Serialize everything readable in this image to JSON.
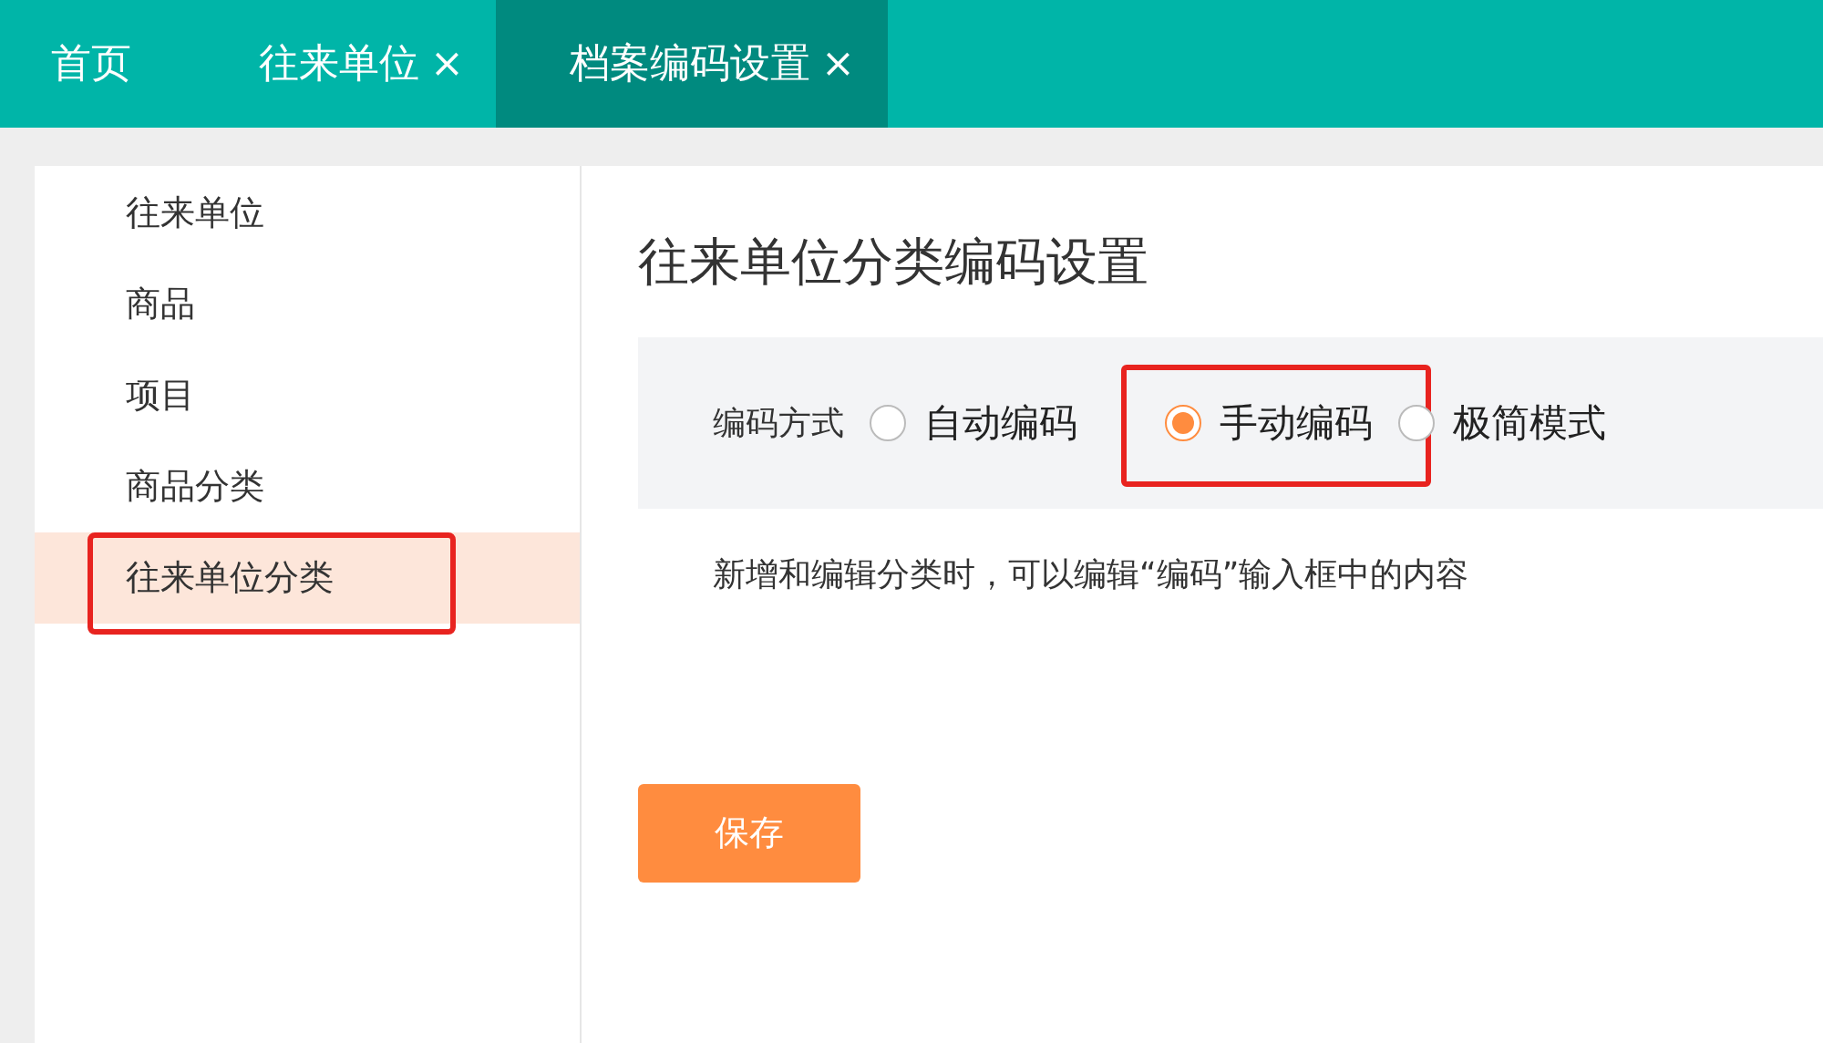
{
  "tabs": [
    {
      "label": "首页",
      "closable": false,
      "selected": false
    },
    {
      "label": "往来单位",
      "closable": true,
      "selected": false
    },
    {
      "label": "档案编码设置",
      "closable": true,
      "selected": true
    }
  ],
  "close_glyph": "×",
  "sidebar": {
    "items": [
      {
        "label": "往来单位",
        "selected": false,
        "highlighted": false
      },
      {
        "label": "商品",
        "selected": false,
        "highlighted": false
      },
      {
        "label": "项目",
        "selected": false,
        "highlighted": false
      },
      {
        "label": "商品分类",
        "selected": false,
        "highlighted": false
      },
      {
        "label": "往来单位分类",
        "selected": true,
        "highlighted": true
      }
    ]
  },
  "content": {
    "title": "往来单位分类编码设置",
    "coding_mode": {
      "label": "编码方式",
      "options": [
        {
          "label": "自动编码",
          "selected": false,
          "highlighted": false
        },
        {
          "label": "手动编码",
          "selected": true,
          "highlighted": true
        },
        {
          "label": "极简模式",
          "selected": false,
          "highlighted": false
        }
      ]
    },
    "hint": "新增和编辑分类时，可以编辑“编码”输入框中的内容",
    "save_button": "保存"
  }
}
